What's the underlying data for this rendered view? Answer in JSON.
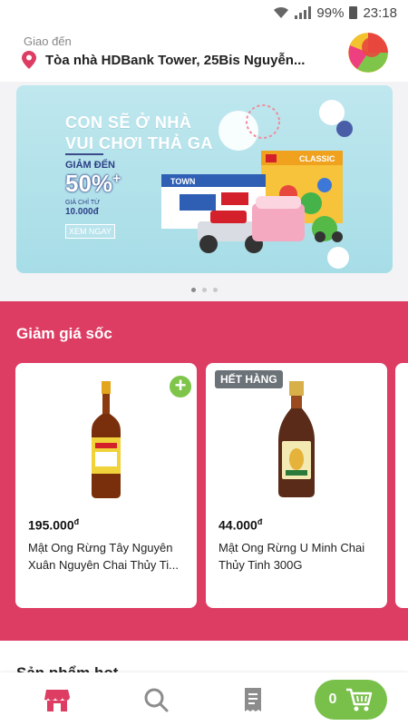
{
  "status_bar": {
    "battery": "99%",
    "time": "23:18"
  },
  "header": {
    "deliver_label": "Giao đến",
    "address": "Tòa nhà HDBank Tower,  25Bis Nguyễn..."
  },
  "banner": {
    "title_line1": "CON SẼ Ở NHÀ",
    "title_line2": "VUI CHƠI THẢ GA",
    "discount_label": "GIẢM ĐẾN",
    "discount_value": "50%",
    "discount_suffix": "+",
    "price_label": "GIÁ CHỈ TỪ",
    "price_value": "10.000đ",
    "cta": "XEM NGAY",
    "product_1_brand": "TOWN",
    "product_2_brand": "CLASSIC"
  },
  "carousel": {
    "page_count": 3,
    "active_index": 0
  },
  "flash_sale": {
    "title": "Giảm giá sốc",
    "products": [
      {
        "price": "195.000",
        "currency": "đ",
        "name": "Mật Ong Rừng Tây Nguyên Xuân Nguyên Chai Thủy Ti...",
        "sold_out": false
      },
      {
        "price": "44.000",
        "currency": "đ",
        "name": "Mật Ong Rừng U Minh Chai Thủy Tinh 300G",
        "sold_out": true,
        "sold_out_label": "HẾT HÀNG"
      }
    ]
  },
  "next_section": {
    "title": "Sản phẩm hot"
  },
  "bottom_nav": {
    "cart_count": "0",
    "items": [
      {
        "icon": "store-icon",
        "active": true
      },
      {
        "icon": "search-icon",
        "active": false
      },
      {
        "icon": "orders-icon",
        "active": false
      }
    ]
  },
  "colors": {
    "brand_pink": "#dd3c63",
    "brand_green": "#79c04b",
    "banner_bg": "#a7dde7"
  }
}
